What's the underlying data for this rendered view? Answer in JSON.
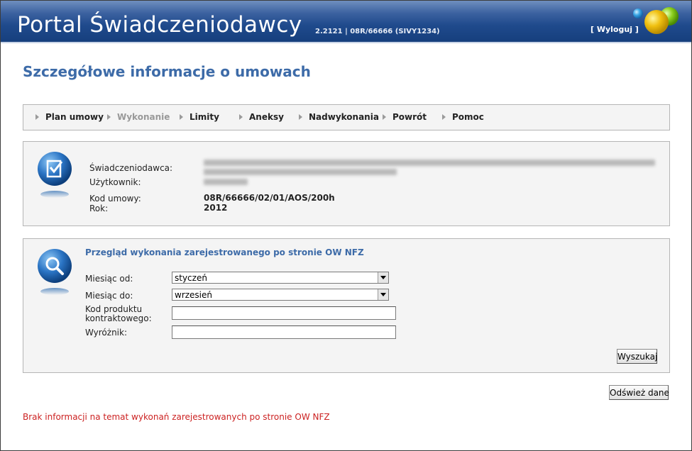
{
  "header": {
    "title": "Portal Świadczeniodawcy",
    "version": "2.2121 | 08R/66666 (SIVY1234)",
    "logout_label": "[ Wyloguj ]"
  },
  "page_title": "Szczegółowe informacje o umowach",
  "nav": {
    "items": [
      {
        "label": "Plan umowy",
        "enabled": true
      },
      {
        "label": "Wykonanie",
        "enabled": false
      },
      {
        "label": "Limity",
        "enabled": true
      },
      {
        "label": "Aneksy",
        "enabled": true
      },
      {
        "label": "Nadwykonania",
        "enabled": true
      },
      {
        "label": "Powrót",
        "enabled": true
      },
      {
        "label": "Pomoc",
        "enabled": true
      }
    ]
  },
  "info": {
    "provider_label": "Świadczeniodawca:",
    "user_label": "Użytkownik:",
    "contract_code_label": "Kod umowy:",
    "contract_code_value": "08R/66666/02/01/AOS/200h",
    "year_label": "Rok:",
    "year_value": "2012"
  },
  "search": {
    "heading": "Przegląd wykonania zarejestrowanego po stronie OW NFZ",
    "month_from_label": "Miesiąc od:",
    "month_from_value": "styczeń",
    "month_to_label": "Miesiąc do:",
    "month_to_value": "wrzesień",
    "product_code_label_line1": "Kod produktu",
    "product_code_label_line2": "kontraktowego:",
    "product_code_value": "",
    "distinguisher_label": "Wyróżnik:",
    "distinguisher_value": "",
    "search_button": "Wyszukaj"
  },
  "refresh_button": "Odśwież dane",
  "message": "Brak informacji na temat wykonań zarejestrowanych po stronie OW NFZ",
  "colors": {
    "header_bg": "#1f4a8c",
    "title_blue": "#3d6ba8",
    "error_red": "#cc2222"
  }
}
